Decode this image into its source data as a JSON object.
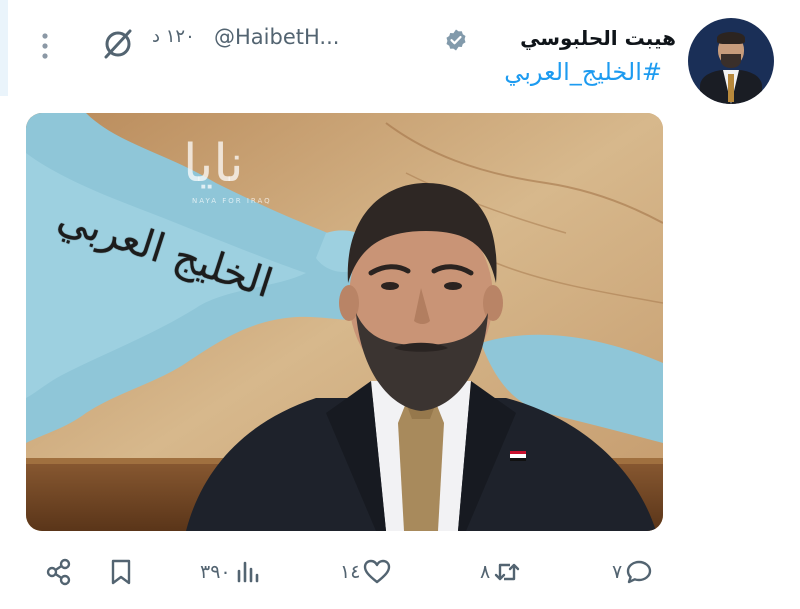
{
  "tweet": {
    "author_name": "هيبت الحلبوسي",
    "handle": "@HaibetH...",
    "time": "١٢٠ د",
    "hashtag": "#الخليج_العربي"
  },
  "media": {
    "watermark": "نايا",
    "watermark_sub": "NAYA FOR IRAQ",
    "map_caption": "الخليج العربي"
  },
  "actions": {
    "views": "٣٩٠",
    "likes": "١٤",
    "retweets": "٨",
    "replies": "٧"
  },
  "icons": {
    "verified": "verified-badge-icon",
    "grok": "grok-icon",
    "more": "more-vertical-icon",
    "share": "share-icon",
    "bookmark": "bookmark-icon",
    "views": "views-chart-icon",
    "like": "heart-icon",
    "retweet": "retweet-icon",
    "reply": "reply-icon"
  },
  "colors": {
    "accent": "#1d9bf0",
    "muted": "#536471",
    "verified": "#829aab"
  }
}
